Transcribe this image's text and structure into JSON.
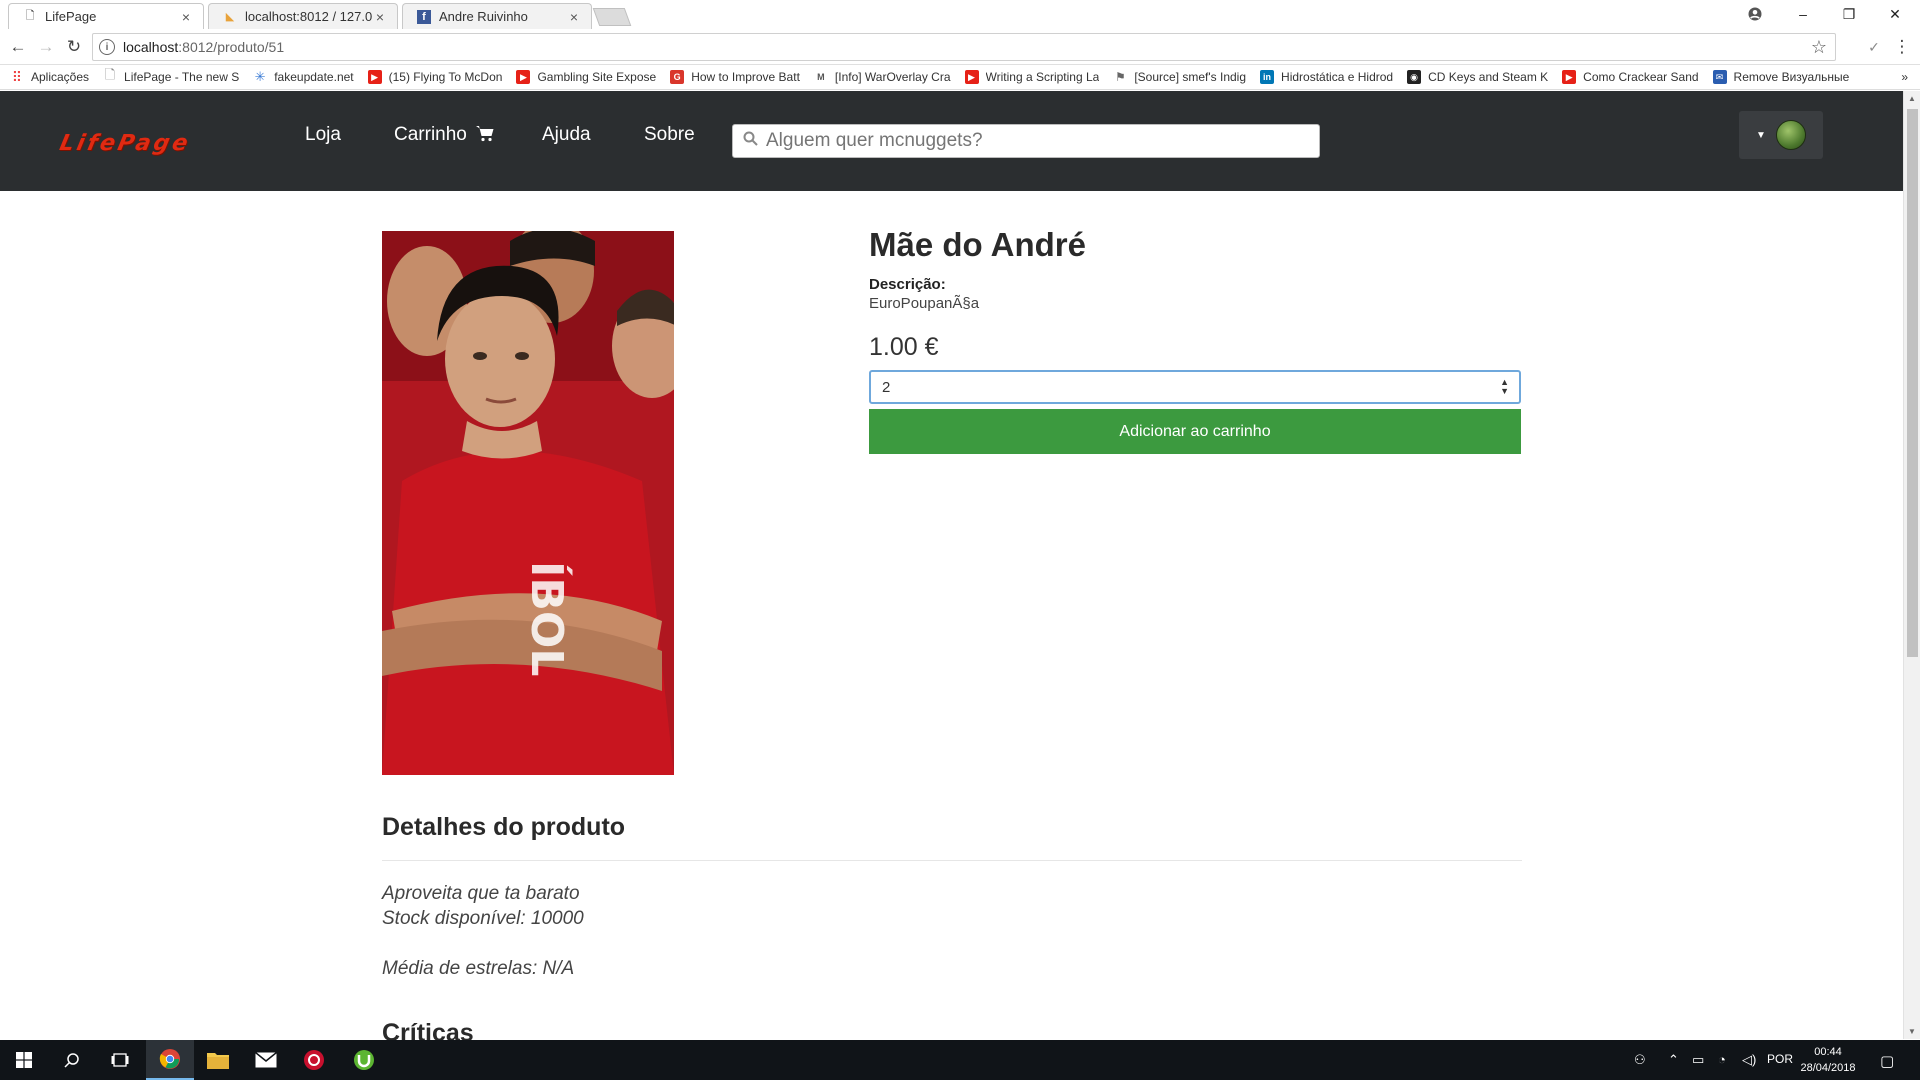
{
  "browser": {
    "tabs": [
      {
        "title": "LifePage",
        "favicon": "page-icon",
        "active": true
      },
      {
        "title": "localhost:8012 / 127.0.0.1",
        "favicon": "phpmyadmin-icon",
        "active": false
      },
      {
        "title": "Andre Ruivinho",
        "favicon": "facebook-icon",
        "active": false
      }
    ],
    "url_host": "localhost",
    "url_path": ":8012/produto/51",
    "bookmarks": [
      {
        "label": "Aplicações",
        "icon": "apps-grid-icon",
        "color": "#e44"
      },
      {
        "label": "LifePage - The new S",
        "icon": "page-icon",
        "color": "#888"
      },
      {
        "label": "fakeupdate.net",
        "icon": "loader-icon",
        "color": "#3a7bd5"
      },
      {
        "label": "(15) Flying To McDon",
        "icon": "youtube-icon",
        "color": "#e62117"
      },
      {
        "label": "Gambling Site Expose",
        "icon": "youtube-icon",
        "color": "#e62117"
      },
      {
        "label": "How to Improve Batt",
        "icon": "g-icon",
        "color": "#d9362b"
      },
      {
        "label": "[Info] WarOverlay Cra",
        "icon": "m-icon",
        "color": "#555"
      },
      {
        "label": "Writing a Scripting La",
        "icon": "youtube-icon",
        "color": "#e62117"
      },
      {
        "label": "[Source] smef's Indig",
        "icon": "flag-icon",
        "color": "#666"
      },
      {
        "label": "Hidrostática e Hidrod",
        "icon": "linkedin-icon",
        "color": "#0077b5"
      },
      {
        "label": "CD Keys and Steam K",
        "icon": "steam-icon",
        "color": "#222"
      },
      {
        "label": "Como Crackear Sand",
        "icon": "youtube-icon",
        "color": "#e62117"
      },
      {
        "label": "Remove Визуальные",
        "icon": "mail-icon",
        "color": "#2a5db0"
      }
    ]
  },
  "site": {
    "logo": "LifePage",
    "nav": {
      "loja": "Loja",
      "carrinho": "Carrinho",
      "ajuda": "Ajuda",
      "sobre": "Sobre"
    },
    "search_placeholder": "Alguem quer mcnuggets?"
  },
  "product": {
    "title": "Mãe do André",
    "description_label": "Descrição:",
    "description": "EuroPoupanÃ§a",
    "price": "1.00 €",
    "quantity": "2",
    "add_to_cart": "Adicionar ao carrinho",
    "details_heading": "Detalhes do produto",
    "details_text": "Aproveita que ta barato",
    "stock": "Stock disponível: 10000",
    "rating": "Média de estrelas: N/A",
    "reviews_heading": "Críticas"
  },
  "taskbar": {
    "language": "POR",
    "time": "00:44",
    "date": "28/04/2018"
  }
}
